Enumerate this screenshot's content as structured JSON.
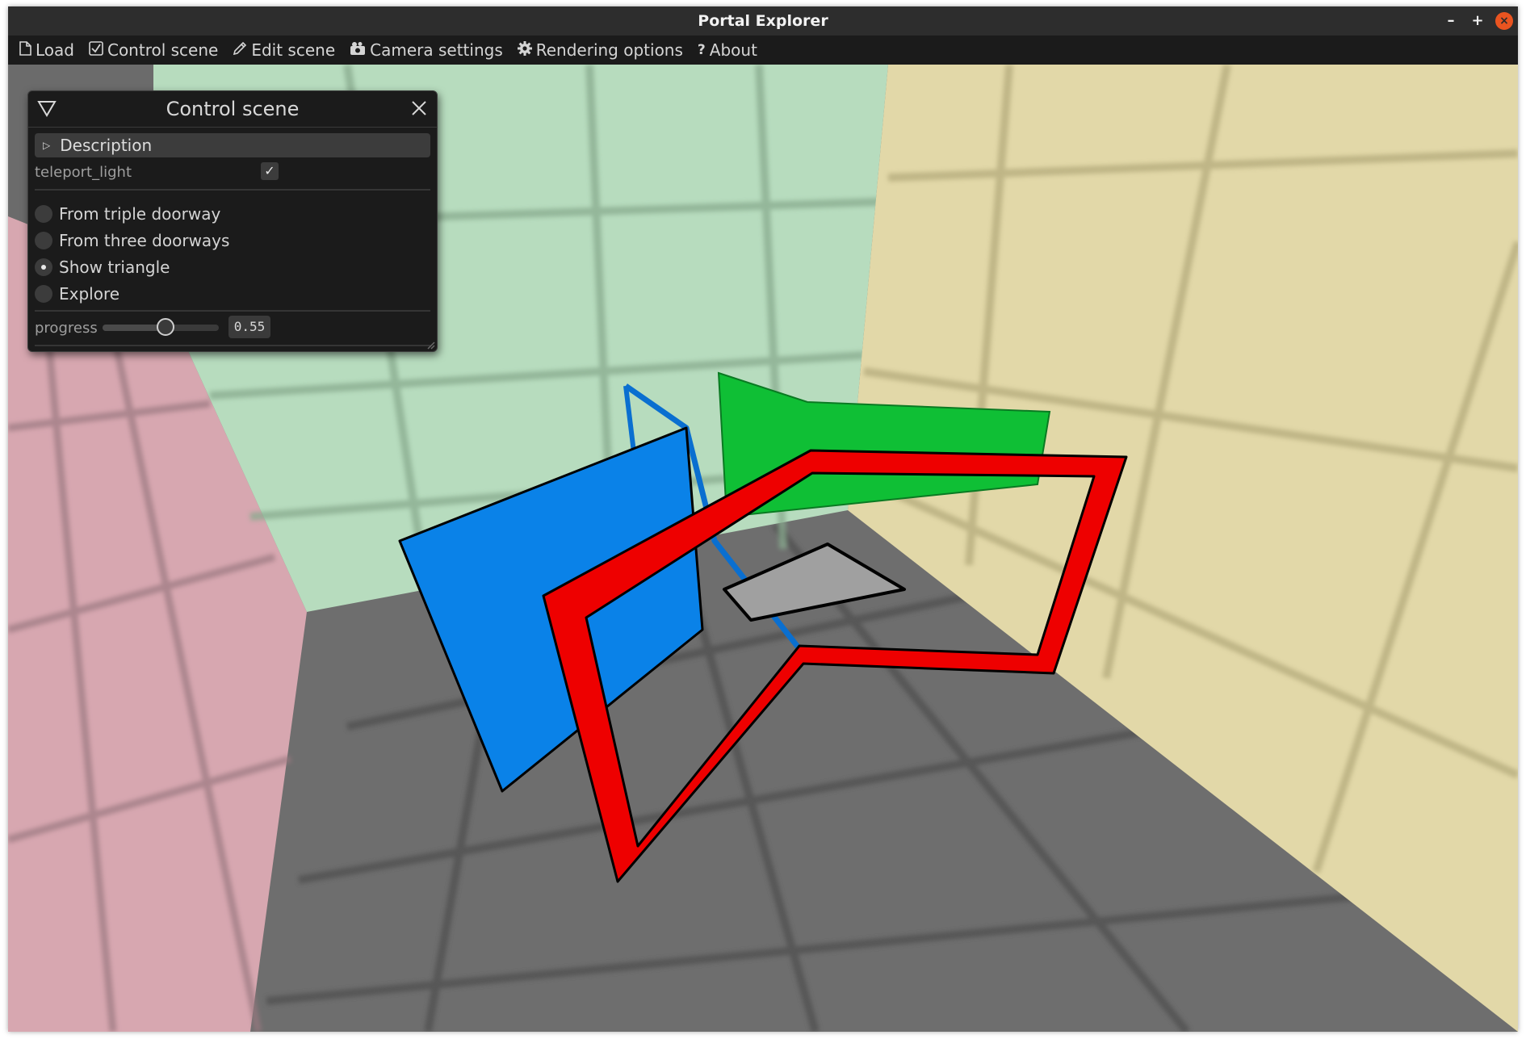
{
  "window": {
    "title": "Portal Explorer",
    "controls": {
      "minimize": "–",
      "maximize": "+",
      "close": "×"
    }
  },
  "menu": [
    {
      "label": "Load",
      "icon": "file-icon"
    },
    {
      "label": "Control scene",
      "icon": "checkbox-icon"
    },
    {
      "label": "Edit scene",
      "icon": "pencil-icon"
    },
    {
      "label": "Camera settings",
      "icon": "camera-icon"
    },
    {
      "label": "Rendering options",
      "icon": "gear-icon"
    },
    {
      "label": "About",
      "icon": "question-icon"
    }
  ],
  "panel": {
    "title": "Control scene",
    "description_label": "Description",
    "teleport_light": {
      "label": "teleport_light",
      "checked": true
    },
    "options": [
      {
        "label": "From triple doorway",
        "selected": false
      },
      {
        "label": "From three doorways",
        "selected": false
      },
      {
        "label": "Show triangle",
        "selected": true
      },
      {
        "label": "Explore",
        "selected": false
      }
    ],
    "progress": {
      "label": "progress",
      "value": 0.55,
      "display": "0.55"
    }
  },
  "scene_colors": {
    "floor": "#6e6e6e",
    "left_wall": "#d7a7b0",
    "back_wall": "#b7dcbe",
    "right_wall": "#e2d8a8",
    "blue_portal": "#0a82e8",
    "green_portal": "#0fbf35",
    "red_portal": "#ee0000",
    "triangle": "#a0a0a0"
  }
}
